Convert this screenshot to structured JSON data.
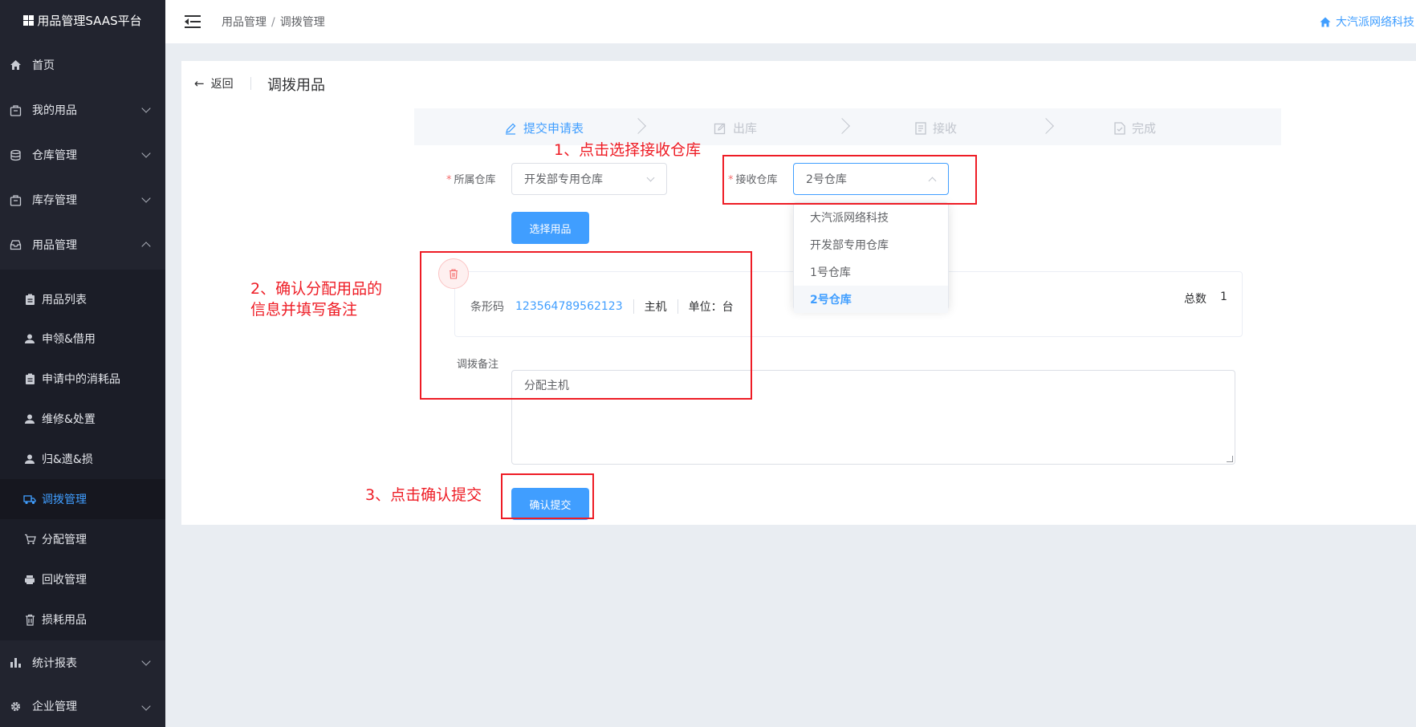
{
  "app": {
    "brand": "用品管理SAAS平台",
    "company": "大汽派网络科技"
  },
  "breadcrumb": [
    "用品管理",
    "调拨管理"
  ],
  "sidebar": {
    "items": [
      {
        "label": "首页",
        "icon": "home-icon"
      },
      {
        "label": "我的用品",
        "icon": "bag-icon"
      },
      {
        "label": "仓库管理",
        "icon": "database-icon"
      },
      {
        "label": "库存管理",
        "icon": "bag-icon"
      },
      {
        "label": "用品管理",
        "icon": "inbox-icon"
      }
    ],
    "sub_items": [
      {
        "label": "用品列表",
        "icon": "clipboard-icon"
      },
      {
        "label": "申领&借用",
        "icon": "user-icon"
      },
      {
        "label": "申请中的消耗品",
        "icon": "clipboard-icon"
      },
      {
        "label": "维修&处置",
        "icon": "user-icon"
      },
      {
        "label": "归&遗&损",
        "icon": "user-icon"
      },
      {
        "label": "调拨管理",
        "icon": "truck-icon",
        "active": true
      },
      {
        "label": "分配管理",
        "icon": "cart-icon"
      },
      {
        "label": "回收管理",
        "icon": "printer-icon"
      },
      {
        "label": "损耗用品",
        "icon": "trash-icon"
      }
    ],
    "bottom_items": [
      {
        "label": "统计报表",
        "icon": "bar-chart-icon"
      },
      {
        "label": "企业管理",
        "icon": "gear-icon"
      }
    ]
  },
  "page": {
    "back_label": "返回",
    "title": "调拨用品"
  },
  "steps": [
    {
      "label": "提交申请表",
      "active": true
    },
    {
      "label": "出库",
      "active": false
    },
    {
      "label": "接收",
      "active": false
    },
    {
      "label": "完成",
      "active": false
    }
  ],
  "form": {
    "source_label": "所属仓库",
    "source_value": "开发部专用仓库",
    "target_label": "接收仓库",
    "target_value": "2号仓库",
    "choose_button": "选择用品",
    "dropdown_options": [
      "大汽派网络科技",
      "开发部专用仓库",
      "1号仓库",
      "2号仓库"
    ],
    "dropdown_selected": "2号仓库",
    "item": {
      "barcode_label": "条形码",
      "barcode": "123564789562123",
      "name": "主机",
      "unit": "单位：台",
      "total_label": "总数",
      "total": "1"
    },
    "remark_label": "调拨备注",
    "remark_value": "分配主机",
    "submit_button": "确认提交"
  },
  "annotations": {
    "step1": "1、点击选择接收仓库",
    "step2_line1": "2、确认分配用品的",
    "step2_line2": "信息并填写备注",
    "step3": "3、点击确认提交"
  },
  "colors": {
    "primary": "#409eff",
    "sidebar_bg": "#22242f",
    "annotation_red": "#ee1c25",
    "required": "#f56c6c"
  }
}
